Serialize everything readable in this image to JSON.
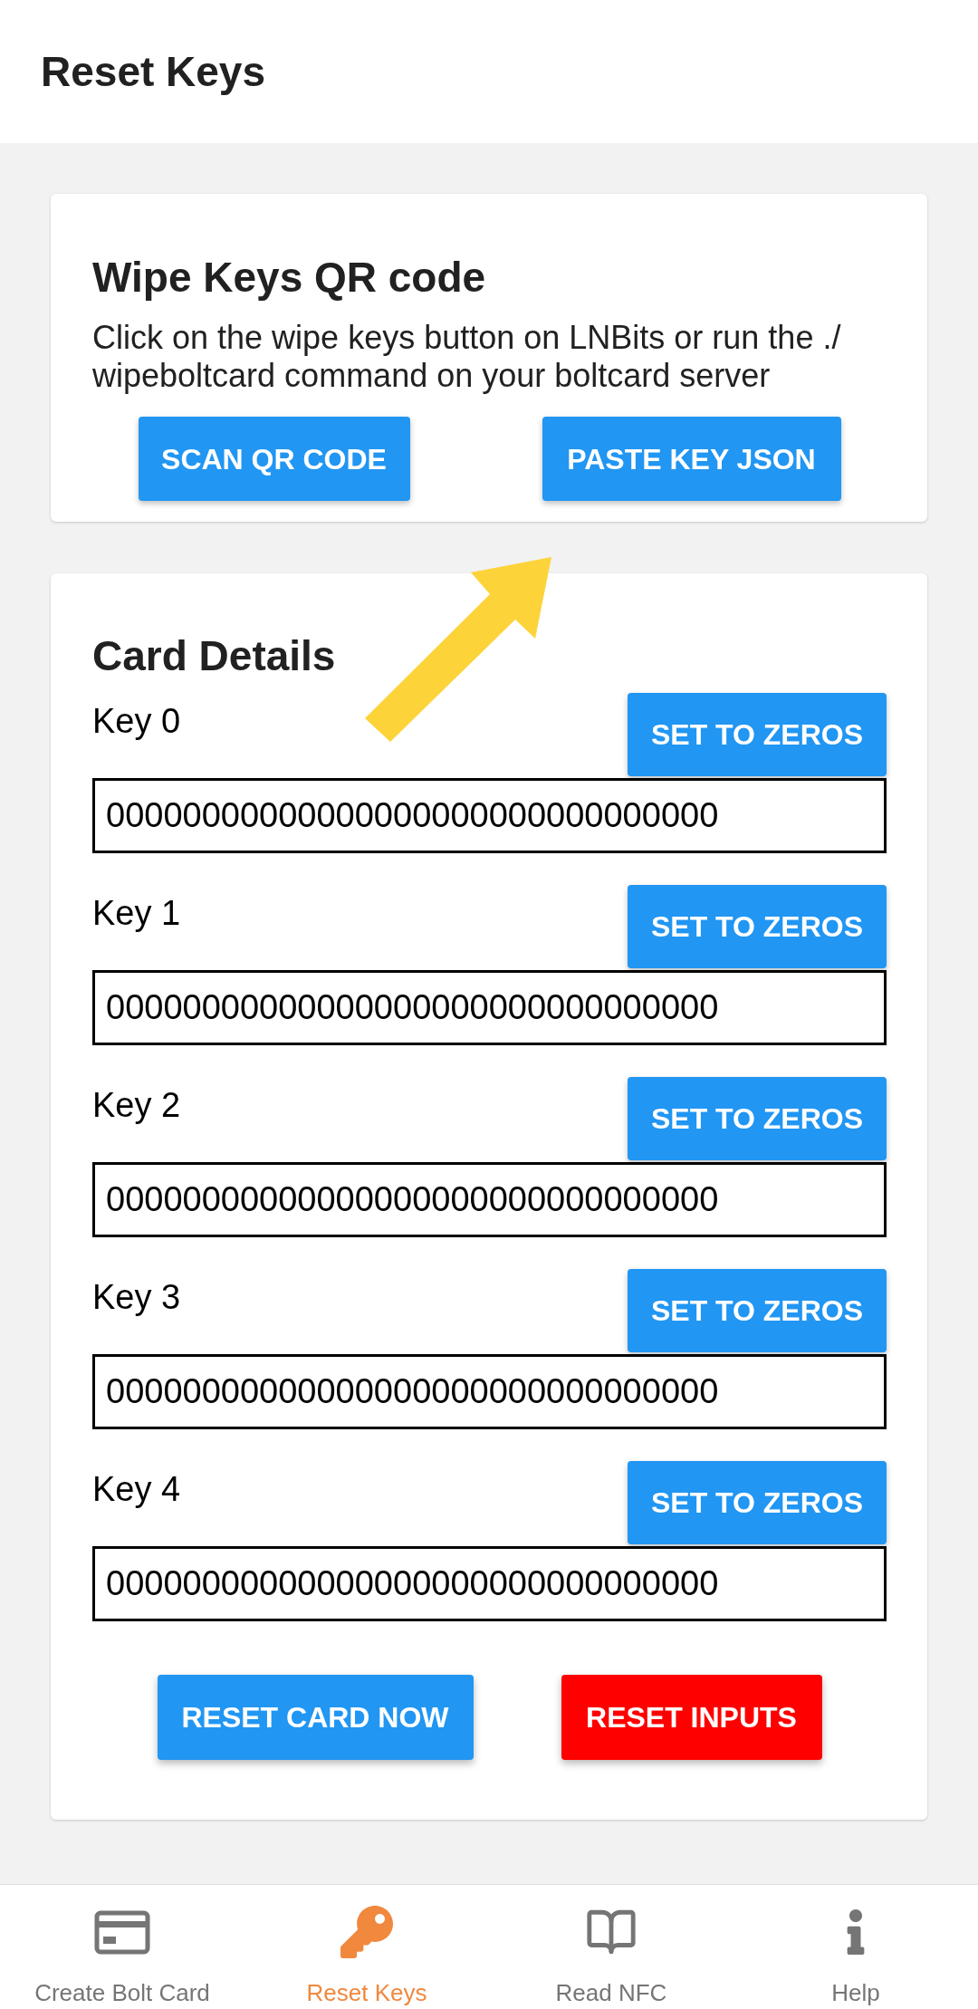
{
  "header": {
    "title": "Reset Keys"
  },
  "wipe_card": {
    "title": "Wipe Keys QR code",
    "description": "Click on the wipe keys button on LNBits or run the ./wipeboltcard command on your boltcard server",
    "buttons": [
      "SCAN QR CODE",
      "PASTE KEY JSON"
    ]
  },
  "details_card": {
    "title": "Card Details",
    "keys": [
      {
        "label": "Key 0",
        "button": "SET TO ZEROS",
        "value": "00000000000000000000000000000000"
      },
      {
        "label": "Key 1",
        "button": "SET TO ZEROS",
        "value": "00000000000000000000000000000000"
      },
      {
        "label": "Key 2",
        "button": "SET TO ZEROS",
        "value": "00000000000000000000000000000000"
      },
      {
        "label": "Key 3",
        "button": "SET TO ZEROS",
        "value": "00000000000000000000000000000000"
      },
      {
        "label": "Key 4",
        "button": "SET TO ZEROS",
        "value": "00000000000000000000000000000000"
      }
    ],
    "buttons": [
      {
        "label": "RESET CARD NOW",
        "kind": "primary"
      },
      {
        "label": "RESET INPUTS",
        "kind": "danger"
      }
    ]
  },
  "nav_tabs": [
    {
      "label": "Create Bolt Card",
      "selected": false
    },
    {
      "label": "Reset Keys",
      "selected": true
    },
    {
      "label": "Read NFC",
      "selected": false
    },
    {
      "label": "Help",
      "selected": false
    }
  ]
}
